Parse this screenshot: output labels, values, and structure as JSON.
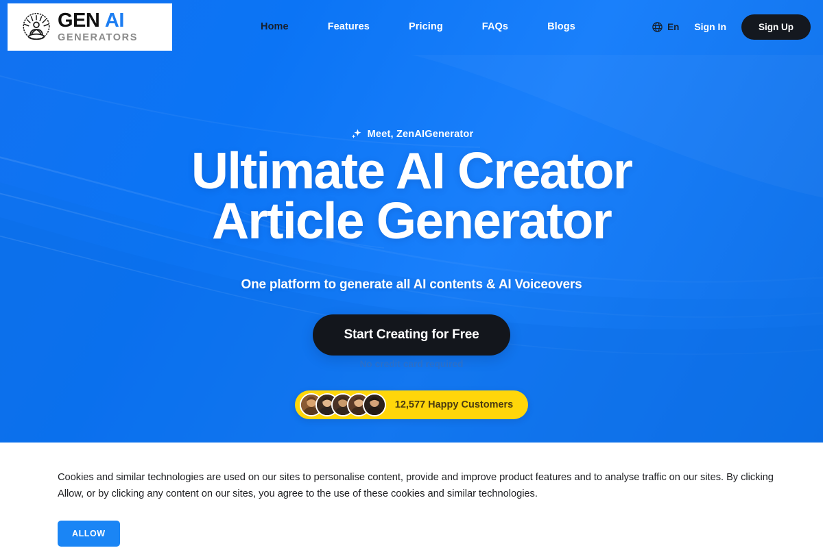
{
  "brand": {
    "logo_icon": "meditating-figure-icon",
    "name_part1": "GEN",
    "name_part2": "AI",
    "tagline": "GENERATORS",
    "accent_color": "#1d7ef2"
  },
  "header": {
    "nav": [
      {
        "label": "Home",
        "active": true
      },
      {
        "label": "Features",
        "active": false
      },
      {
        "label": "Pricing",
        "active": false
      },
      {
        "label": "FAQs",
        "active": false
      },
      {
        "label": "Blogs",
        "active": false
      }
    ],
    "language": {
      "icon": "globe-icon",
      "label": "En"
    },
    "sign_in_label": "Sign In",
    "sign_up_label": "Sign Up",
    "sign_up_bg": "#14181f"
  },
  "hero": {
    "eyebrow_icon": "sparkle-icon",
    "eyebrow": "Meet, ZenAIGenerator",
    "headline_line1": "Ultimate AI Creator",
    "headline_line2": "Article Generator",
    "subhead": "One platform to generate all AI contents & AI Voiceovers",
    "cta_label": "Start Creating for Free",
    "cta_bg": "#13161c",
    "no_credit_card": "No credit card required",
    "background_color": "#0b74f5",
    "social_proof": {
      "count_label": "12,577 Happy Customers",
      "pill_color": "#ffd60a",
      "avatar_count": 5
    }
  },
  "cookie_banner": {
    "text": "Cookies and similar technologies are used on our sites to personalise content, provide and improve product features and to analyse traffic on our sites. By clicking Allow, or by clicking any content on our sites, you agree to the use of these cookies and similar technologies.",
    "allow_label": "ALLOW",
    "allow_bg": "#1a85f5"
  }
}
